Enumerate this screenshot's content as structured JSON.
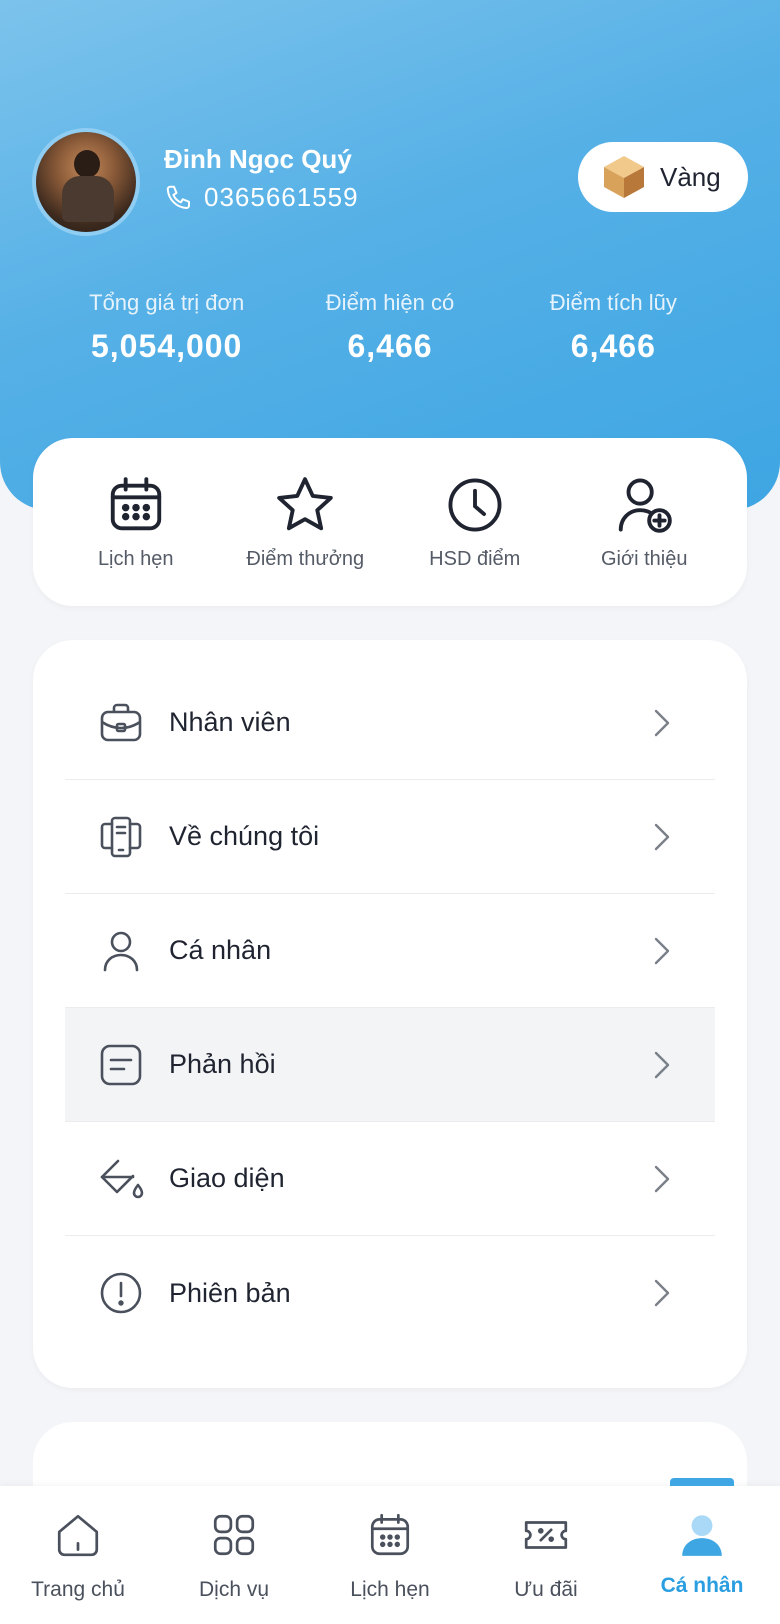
{
  "profile": {
    "name": "Đinh Ngọc Quý",
    "phone": "0365661559",
    "tier": "Vàng"
  },
  "stats": [
    {
      "label": "Tổng giá trị đơn",
      "value": "5,054,000"
    },
    {
      "label": "Điểm hiện có",
      "value": "6,466"
    },
    {
      "label": "Điểm tích lũy",
      "value": "6,466"
    }
  ],
  "shortcuts": [
    {
      "label": "Lịch hẹn",
      "icon": "calendar-icon"
    },
    {
      "label": "Điểm thưởng",
      "icon": "star-icon"
    },
    {
      "label": "HSD điểm",
      "icon": "clock-icon"
    },
    {
      "label": "Giới thiệu",
      "icon": "user-add-icon"
    }
  ],
  "menu": [
    {
      "label": "Nhân viên",
      "icon": "briefcase-icon"
    },
    {
      "label": "Về chúng tôi",
      "icon": "documents-icon"
    },
    {
      "label": "Cá nhân",
      "icon": "user-icon"
    },
    {
      "label": "Phản hồi",
      "icon": "feedback-icon",
      "active": true
    },
    {
      "label": "Giao diện",
      "icon": "paint-bucket-icon"
    },
    {
      "label": "Phiên bản",
      "icon": "info-icon"
    }
  ],
  "nav": [
    {
      "label": "Trang chủ",
      "icon": "home-icon"
    },
    {
      "label": "Dịch vụ",
      "icon": "grid-icon"
    },
    {
      "label": "Lịch hẹn",
      "icon": "calendar-icon"
    },
    {
      "label": "Ưu đãi",
      "icon": "ticket-icon"
    },
    {
      "label": "Cá nhân",
      "icon": "user-icon",
      "active": true
    }
  ],
  "colors": {
    "header_start": "#7cc3ec",
    "header_end": "#3ea6e3",
    "accent": "#2a9ee0",
    "background": "#f4f5f8"
  }
}
